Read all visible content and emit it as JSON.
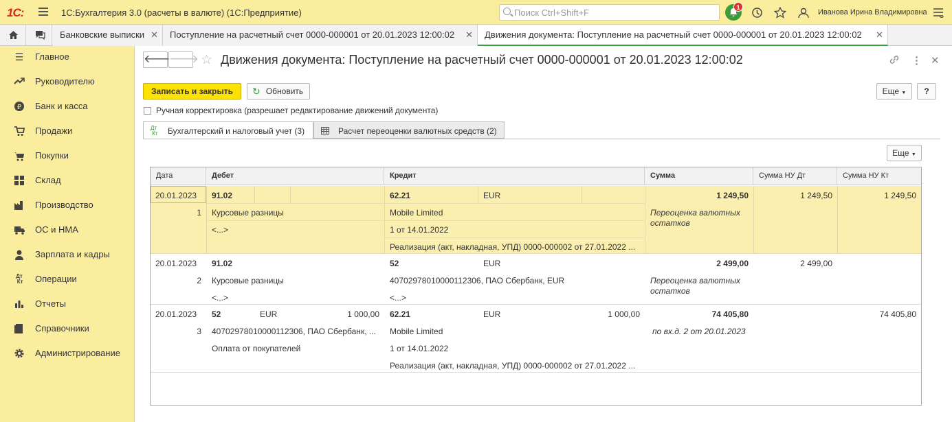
{
  "app": {
    "logo": "1С:",
    "title": "1С:Бухгалтерия 3.0 (расчеты в валюте)  (1С:Предприятие)",
    "search_placeholder": "Поиск Ctrl+Shift+F",
    "notifications": "1",
    "user": "Иванова Ирина Владимировна"
  },
  "tabs": [
    {
      "label": "Банковские выписки"
    },
    {
      "label": "Поступление на расчетный счет 0000-000001 от 20.01.2023 12:00:02"
    },
    {
      "label": "Движения документа: Поступление на расчетный счет 0000-000001 от 20.01.2023 12:00:02"
    }
  ],
  "sidebar": [
    {
      "label": "Главное",
      "icon": "menu-icon"
    },
    {
      "label": "Руководителю",
      "icon": "trend-icon"
    },
    {
      "label": "Банк и касса",
      "icon": "ruble-icon"
    },
    {
      "label": "Продажи",
      "icon": "cart-icon"
    },
    {
      "label": "Покупки",
      "icon": "basket-icon"
    },
    {
      "label": "Склад",
      "icon": "warehouse-icon"
    },
    {
      "label": "Производство",
      "icon": "factory-icon"
    },
    {
      "label": "ОС и НМА",
      "icon": "truck-icon"
    },
    {
      "label": "Зарплата и кадры",
      "icon": "person-icon"
    },
    {
      "label": "Операции",
      "icon": "dt-kt-icon"
    },
    {
      "label": "Отчеты",
      "icon": "bar-chart-icon"
    },
    {
      "label": "Справочники",
      "icon": "book-icon"
    },
    {
      "label": "Администрирование",
      "icon": "gear-icon"
    }
  ],
  "form": {
    "title": "Движения документа: Поступление на расчетный счет 0000-000001 от 20.01.2023 12:00:02",
    "save_close": "Записать и закрыть",
    "refresh": "Обновить",
    "more": "Еще",
    "help": "?",
    "manual_label": "Ручная корректировка (разрешает редактирование движений документа)",
    "page_tabs": [
      {
        "label": "Бухгалтерский и налоговый учет (3)"
      },
      {
        "label": "Расчет переоценки валютных средств (2)"
      }
    ],
    "table_more": "Еще"
  },
  "table": {
    "headers": [
      "Дата",
      "Дебет",
      "Кредит",
      "Сумма",
      "Сумма НУ Дт",
      "Сумма НУ Кт"
    ],
    "rows": [
      {
        "date": "20.01.2023",
        "num": "1",
        "dt_account": "91.02",
        "dt_cur": "",
        "dt_amount": "",
        "dt_sub1": "Курсовые разницы",
        "dt_sub2": "<...>",
        "dt_sub3": "",
        "kt_account": "62.21",
        "kt_cur": "EUR",
        "kt_amount": "",
        "kt_sub1": "Mobile Limited",
        "kt_sub2": "1 от 14.01.2022",
        "kt_sub3": "Реализация (акт, накладная, УПД) 0000-000002 от 27.01.2022 ...",
        "sum": "1 249,50",
        "content": "Переоценка валютных остатков",
        "nu_dt": "1 249,50",
        "nu_kt": "1 249,50"
      },
      {
        "date": "20.01.2023",
        "num": "2",
        "dt_account": "91.02",
        "dt_cur": "",
        "dt_amount": "",
        "dt_sub1": "Курсовые разницы",
        "dt_sub2": "<...>",
        "dt_sub3": "",
        "kt_account": "52",
        "kt_cur": "EUR",
        "kt_amount": "",
        "kt_sub1": "40702978010000112306, ПАО Сбербанк, EUR",
        "kt_sub2": "<...>",
        "kt_sub3": "",
        "sum": "2 499,00",
        "content": "Переоценка валютных остатков",
        "nu_dt": "2 499,00",
        "nu_kt": ""
      },
      {
        "date": "20.01.2023",
        "num": "3",
        "dt_account": "52",
        "dt_cur": "EUR",
        "dt_amount": "1 000,00",
        "dt_sub1": "40702978010000112306, ПАО Сбербанк, ...",
        "dt_sub2": "Оплата от покупателей",
        "dt_sub3": "",
        "kt_account": "62.21",
        "kt_cur": "EUR",
        "kt_amount": "1 000,00",
        "kt_sub1": "Mobile Limited",
        "kt_sub2": "1 от 14.01.2022",
        "kt_sub3": "Реализация (акт, накладная, УПД) 0000-000002 от 27.01.2022 ...",
        "sum": "74 405,80",
        "content": "по вх.д. 2 от 20.01.2023",
        "nu_dt": "",
        "nu_kt": "74 405,80"
      }
    ]
  }
}
